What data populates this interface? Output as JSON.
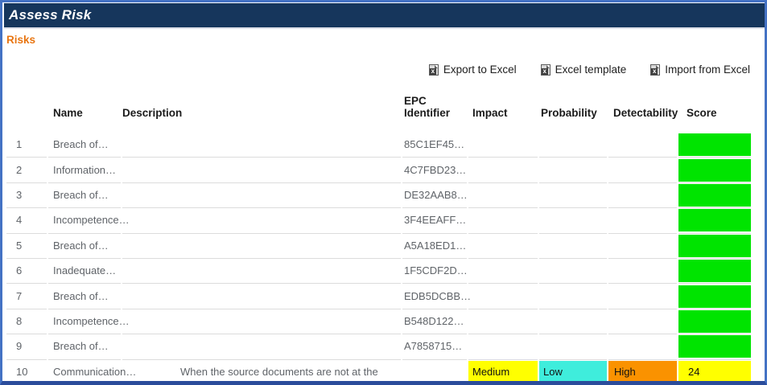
{
  "window": {
    "title": "Assess Risk"
  },
  "page": {
    "section_label": "Risks"
  },
  "toolbar": {
    "export_label": "Export to Excel",
    "template_label": "Excel template",
    "import_label": "Import from Excel",
    "icon": "excel-file-icon"
  },
  "colors": {
    "frame_border": "#4472C4",
    "frame_bottom": "#2B4C9B",
    "titlebar_bg": "#16365C",
    "section_label": "#E87511",
    "score_green": "#00E400",
    "impact_yellow": "#FFFF00",
    "probability_cyan": "#3FEDDC",
    "detectability_orange": "#FA9200",
    "row_text": "#5F6368",
    "divider": "#DCDCDC"
  },
  "table": {
    "headers": {
      "num": "",
      "name": "Name",
      "description": "Description",
      "epc": "EPC Identifier",
      "impact": "Impact",
      "probability": "Probability",
      "detectability": "Detectability",
      "score": "Score"
    },
    "rows": [
      {
        "num": "1",
        "name": "Breach of…",
        "description": "",
        "epc": "85C1EF45…",
        "impact": "",
        "impact_bg": "",
        "probability": "",
        "probability_bg": "",
        "detectability": "",
        "detectability_bg": "",
        "score": "",
        "score_bg": "#00E400"
      },
      {
        "num": "2",
        "name": "Information…",
        "description": "",
        "epc": "4C7FBD23…",
        "impact": "",
        "impact_bg": "",
        "probability": "",
        "probability_bg": "",
        "detectability": "",
        "detectability_bg": "",
        "score": "",
        "score_bg": "#00E400"
      },
      {
        "num": "3",
        "name": "Breach of…",
        "description": "",
        "epc": "DE32AAB8…",
        "impact": "",
        "impact_bg": "",
        "probability": "",
        "probability_bg": "",
        "detectability": "",
        "detectability_bg": "",
        "score": "",
        "score_bg": "#00E400"
      },
      {
        "num": "4",
        "name": "Incompetence…",
        "description": "",
        "epc": "3F4EEAFF…",
        "impact": "",
        "impact_bg": "",
        "probability": "",
        "probability_bg": "",
        "detectability": "",
        "detectability_bg": "",
        "score": "",
        "score_bg": "#00E400"
      },
      {
        "num": "5",
        "name": "Breach of…",
        "description": "",
        "epc": "A5A18ED1…",
        "impact": "",
        "impact_bg": "",
        "probability": "",
        "probability_bg": "",
        "detectability": "",
        "detectability_bg": "",
        "score": "",
        "score_bg": "#00E400"
      },
      {
        "num": "6",
        "name": "Inadequate…",
        "description": "",
        "epc": "1F5CDF2D…",
        "impact": "",
        "impact_bg": "",
        "probability": "",
        "probability_bg": "",
        "detectability": "",
        "detectability_bg": "",
        "score": "",
        "score_bg": "#00E400"
      },
      {
        "num": "7",
        "name": "Breach of…",
        "description": "",
        "epc": "EDB5DCBB…",
        "impact": "",
        "impact_bg": "",
        "probability": "",
        "probability_bg": "",
        "detectability": "",
        "detectability_bg": "",
        "score": "",
        "score_bg": "#00E400"
      },
      {
        "num": "8",
        "name": "Incompetence…",
        "description": "",
        "epc": "B548D122…",
        "impact": "",
        "impact_bg": "",
        "probability": "",
        "probability_bg": "",
        "detectability": "",
        "detectability_bg": "",
        "score": "",
        "score_bg": "#00E400"
      },
      {
        "num": "9",
        "name": "Breach of…",
        "description": "",
        "epc": "A7858715…",
        "impact": "",
        "impact_bg": "",
        "probability": "",
        "probability_bg": "",
        "detectability": "",
        "detectability_bg": "",
        "score": "",
        "score_bg": "#00E400"
      },
      {
        "num": "10",
        "name": "Communication…",
        "description": "When the source documents are not at the",
        "epc": "",
        "impact": "Medium",
        "impact_bg": "#FFFF00",
        "probability": "Low",
        "probability_bg": "#3FEDDC",
        "detectability": "High",
        "detectability_bg": "#FA9200",
        "score": "24",
        "score_bg": "#FFFF00"
      }
    ]
  }
}
